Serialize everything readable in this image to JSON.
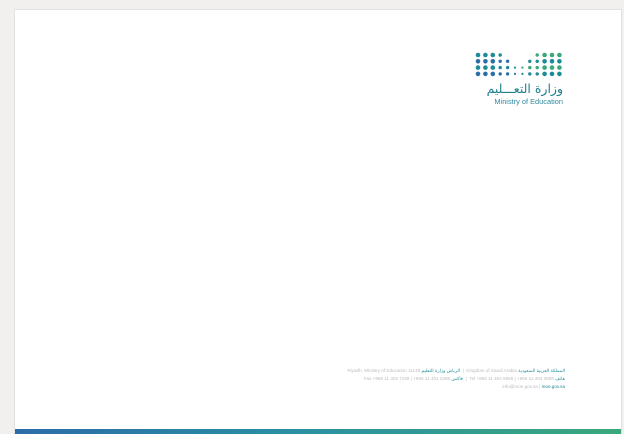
{
  "logo": {
    "name_ar": "وزارة التعـــليم",
    "name_en": "Ministry of Education",
    "colors": {
      "teal": "#1e8c96",
      "green": "#3aa877",
      "blue": "#2c6fa6"
    }
  },
  "footer": {
    "line1": {
      "address_en": "Riyadh, Ministry of Education 11148",
      "address_ar": "الرياض وزارة التعليم",
      "separator": "|",
      "country_en": "Kingdom of Saudi Arabia",
      "country_ar": "المملكة العربية السعودية"
    },
    "line2": {
      "fax": "Fax +966 11 403 7229 | +966 11 401 2365",
      "fax_ar": "فاكس",
      "tel": "Tel +966 11 404 6666 | +966 11 404 2888",
      "tel_ar": "هاتف"
    },
    "line3": {
      "email": "info@moe.gov.sa",
      "separator": "|",
      "website": "moe.gov.sa"
    }
  },
  "accent_bar": {
    "from": "#2b6ca8",
    "to": "#3aa77c"
  }
}
